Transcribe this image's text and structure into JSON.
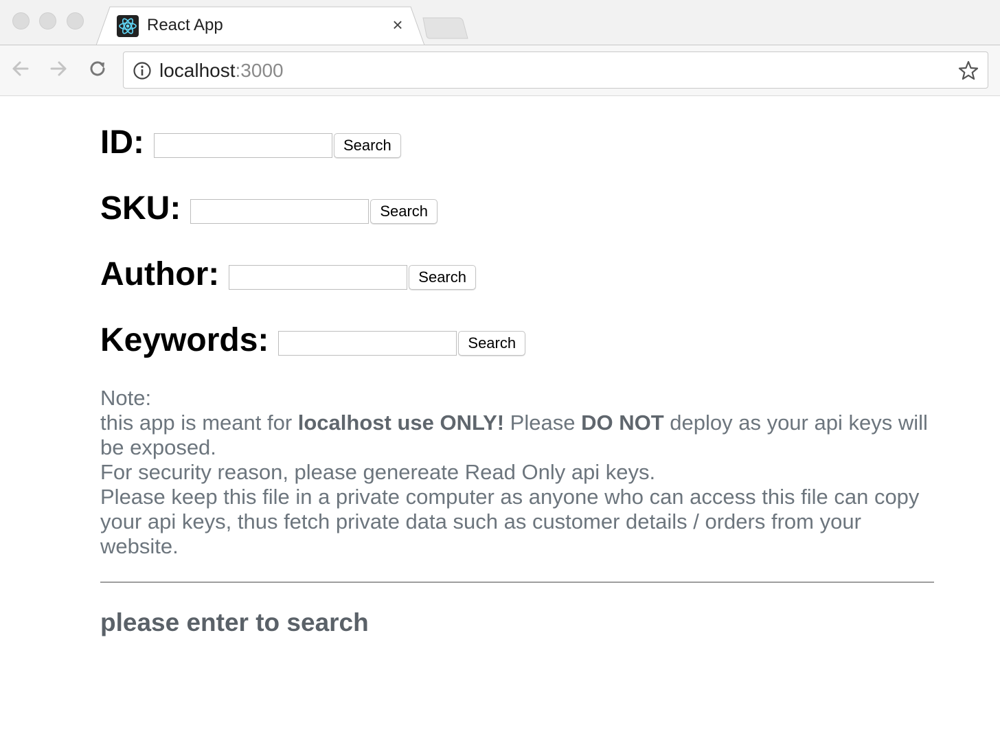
{
  "browser": {
    "tab_title": "React App",
    "close_glyph": "×",
    "url_host": "localhost",
    "url_port": ":3000",
    "icons": [
      "react-logo-icon",
      "close-icon",
      "back-icon",
      "forward-icon",
      "reload-icon",
      "info-icon",
      "star-icon"
    ]
  },
  "search_fields": [
    {
      "label": "ID:",
      "value": "",
      "button": "Search"
    },
    {
      "label": "SKU:",
      "value": "",
      "button": "Search"
    },
    {
      "label": "Author:",
      "value": "",
      "button": "Search"
    },
    {
      "label": "Keywords:",
      "value": "",
      "button": "Search"
    }
  ],
  "note": {
    "heading": "Note:",
    "line1_a": "this app is meant for ",
    "line1_b": "localhost use ONLY!",
    "line1_c": " Please ",
    "line1_d": "DO NOT",
    "line1_e": " deploy as your api keys will be exposed.",
    "line2": "For security reason, please genereate Read Only api keys.",
    "line3": "Please keep this file in a private computer as anyone who can access this file can copy your api keys, thus fetch private data such as customer details / orders from your website."
  },
  "status_text": "please enter to search",
  "colors": {
    "note_text": "#6c757d",
    "status_text": "#5a6168",
    "divider": "#9e9e9e"
  }
}
